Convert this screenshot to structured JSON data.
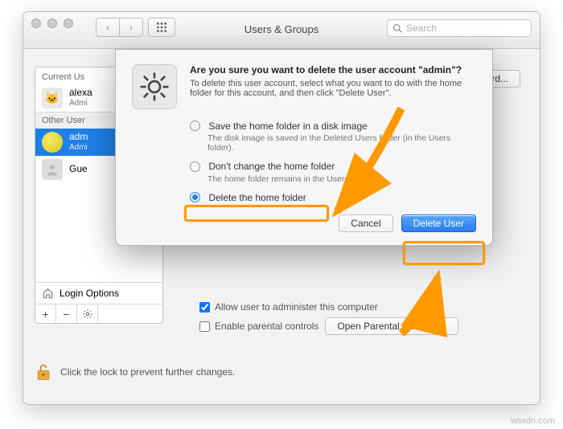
{
  "toolbar": {
    "title": "Users & Groups",
    "search_placeholder": "Search"
  },
  "sidebar": {
    "current_header": "Current Us",
    "other_header": "Other User",
    "login_options": "Login Options",
    "users": {
      "current": {
        "name": "alexa",
        "role": "Admi"
      },
      "other1": {
        "name": "adm",
        "role": "Admi"
      },
      "guest": {
        "name": "Gue",
        "role": ""
      }
    }
  },
  "right": {
    "change_password": "rd...",
    "admin_checkbox": "Allow user to administer this computer",
    "parental_checkbox": "Enable parental controls",
    "open_parental_btn": "Open Parental Controls..."
  },
  "lock": {
    "text": "Click the lock to prevent further changes."
  },
  "sheet": {
    "heading": "Are you sure you want to delete the user account \"admin\"?",
    "subtext": "To delete this user account, select what you want to do with the home folder for this account, and then click \"Delete User\".",
    "opt1": {
      "label": "Save the home folder in a disk image",
      "desc": "The disk image is saved in the Deleted Users folder (in the Users folder)."
    },
    "opt2": {
      "label": "Don't change the home folder",
      "desc": "The home folder remains in the Users folder."
    },
    "opt3": {
      "label": "Delete the home folder"
    },
    "cancel": "Cancel",
    "delete": "Delete User"
  },
  "watermark": "wsxdn.com"
}
